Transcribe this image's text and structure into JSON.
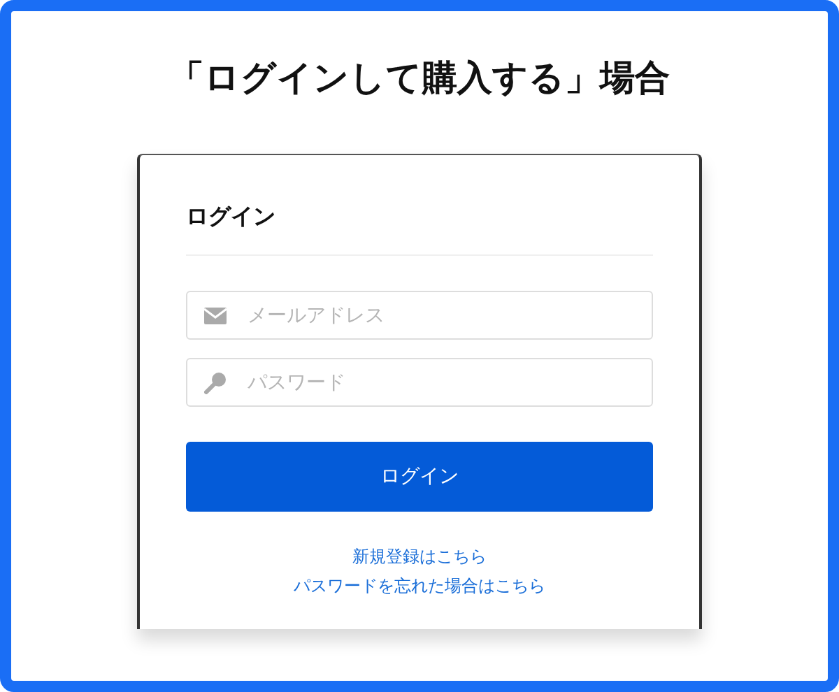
{
  "heading": "「ログインして購入する」場合",
  "login_card": {
    "title": "ログイン",
    "fields": [
      {
        "kind": "email",
        "placeholder": "メールアドレス"
      },
      {
        "kind": "password",
        "placeholder": "パスワード"
      }
    ],
    "submit_button": "ログイン",
    "links": [
      "新規登録はこちら",
      "パスワードを忘れた場合はこちら"
    ]
  }
}
